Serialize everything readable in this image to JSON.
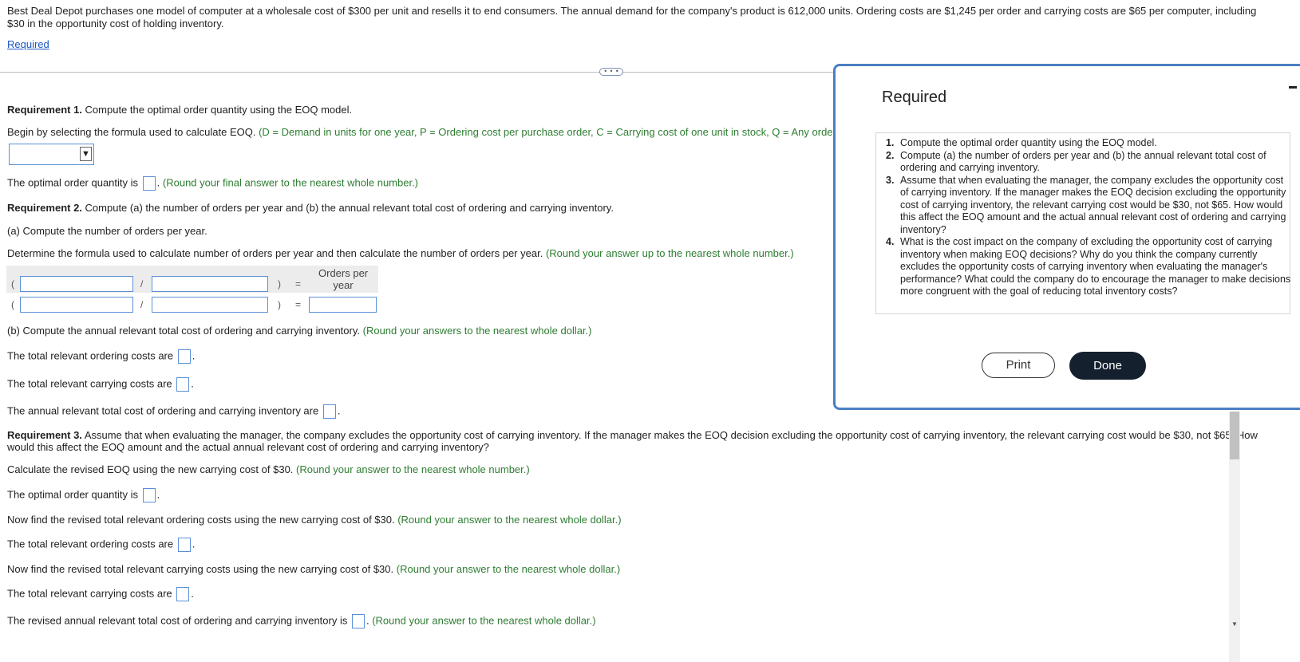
{
  "intro": "Best Deal Depot purchases one model of computer at a wholesale cost of $300 per unit and resells it to end consumers. The annual demand for the company's product is 612,000 units. Ordering costs are $1,245 per order and carrying costs are $65 per computer, including $30 in the opportunity cost of holding inventory.",
  "required_link": "Required",
  "divider_handle": "• • •",
  "req1": {
    "heading": "Requirement 1.",
    "text": " Compute the optimal order quantity using the EOQ model.",
    "formula_prompt": "Begin by selecting the formula used to calculate EOQ.",
    "formula_hint": "(D = Demand in units for one year, P = Ordering cost per purchase order, C = Carrying cost of one unit in stock, Q = Any order quantit",
    "dropdown_arrow": "▼",
    "oq_label": "The optimal order quantity is",
    "oq_hint": "(Round your final answer to the nearest whole number.)"
  },
  "req2": {
    "heading": "Requirement 2.",
    "text": " Compute (a) the number of orders per year and (b) the annual relevant total cost of ordering and carrying inventory.",
    "part_a": "(a) Compute the number of orders per year.",
    "determine": "Determine the formula used to calculate number of orders per year and then calculate the number of orders per year.",
    "determine_hint": "(Round your answer up to the nearest whole number.)",
    "formula": {
      "open": "(",
      "divide": "/",
      "close": ")",
      "equals": "=",
      "result_label_1": "Orders per",
      "result_label_2": "year"
    },
    "part_b": "(b) Compute the annual relevant total cost of ordering and carrying inventory.",
    "part_b_hint": "(Round your answers to the nearest whole dollar.)",
    "ordering_label": "The total relevant ordering costs are",
    "carrying_label": "The total relevant carrying costs are",
    "total_label": "The annual relevant total cost of ordering and carrying inventory are"
  },
  "req3": {
    "heading": "Requirement 3.",
    "text_line1": " Assume that when evaluating the manager, the company excludes the opportunity cost of carrying inventory. If the manager makes the EOQ decision excluding the opportunity cost of carrying inventory, the relevant carrying cost would be $30, not $65. How",
    "text_line2": "would this affect the EOQ amount and the actual annual relevant cost of ordering and carrying inventory?",
    "calc": "Calculate the revised EOQ using the new carrying cost of $30.",
    "calc_hint": "(Round your answer to the nearest whole number.)",
    "oq_label": "The optimal order quantity is",
    "ordering_prompt": "Now find the revised total relevant ordering costs using the new carrying cost of $30.",
    "ordering_hint": "(Round your answer to the nearest whole dollar.)",
    "ordering_label": "The total relevant ordering costs are",
    "carrying_prompt": "Now find the revised total relevant carrying costs using the new carrying cost of $30.",
    "carrying_hint": "(Round your answer to the nearest whole dollar.)",
    "carrying_label": "The total relevant carrying costs are",
    "revised_total_label": "The revised annual relevant total cost of ordering and carrying inventory is",
    "revised_total_hint": "(Round your answer to the nearest whole dollar.)"
  },
  "modal": {
    "title": "Required",
    "items": [
      {
        "num": "1.",
        "text": "Compute the optimal order quantity using the EOQ model."
      },
      {
        "num": "2.",
        "text": "Compute (a) the number of orders per year and (b) the annual relevant total cost of ordering and carrying inventory."
      },
      {
        "num": "3.",
        "text": "Assume that when evaluating the manager, the company excludes the opportunity cost of carrying inventory. If the manager makes the EOQ decision excluding the opportunity cost of carrying inventory, the relevant carrying cost would be $30, not $65. How would this affect the EOQ amount and the actual annual relevant cost of ordering and carrying inventory?"
      },
      {
        "num": "4.",
        "text": "What is the cost impact on the company of excluding the opportunity cost of carrying inventory when making EOQ decisions? Why do you think the company currently excludes the opportunity costs of carrying inventory when evaluating the manager's performance? What could the company do to encourage the manager to make decisions more congruent with the goal of reducing total inventory costs?"
      }
    ],
    "print_label": "Print",
    "done_label": "Done"
  },
  "scroll_down_glyph": "▼"
}
